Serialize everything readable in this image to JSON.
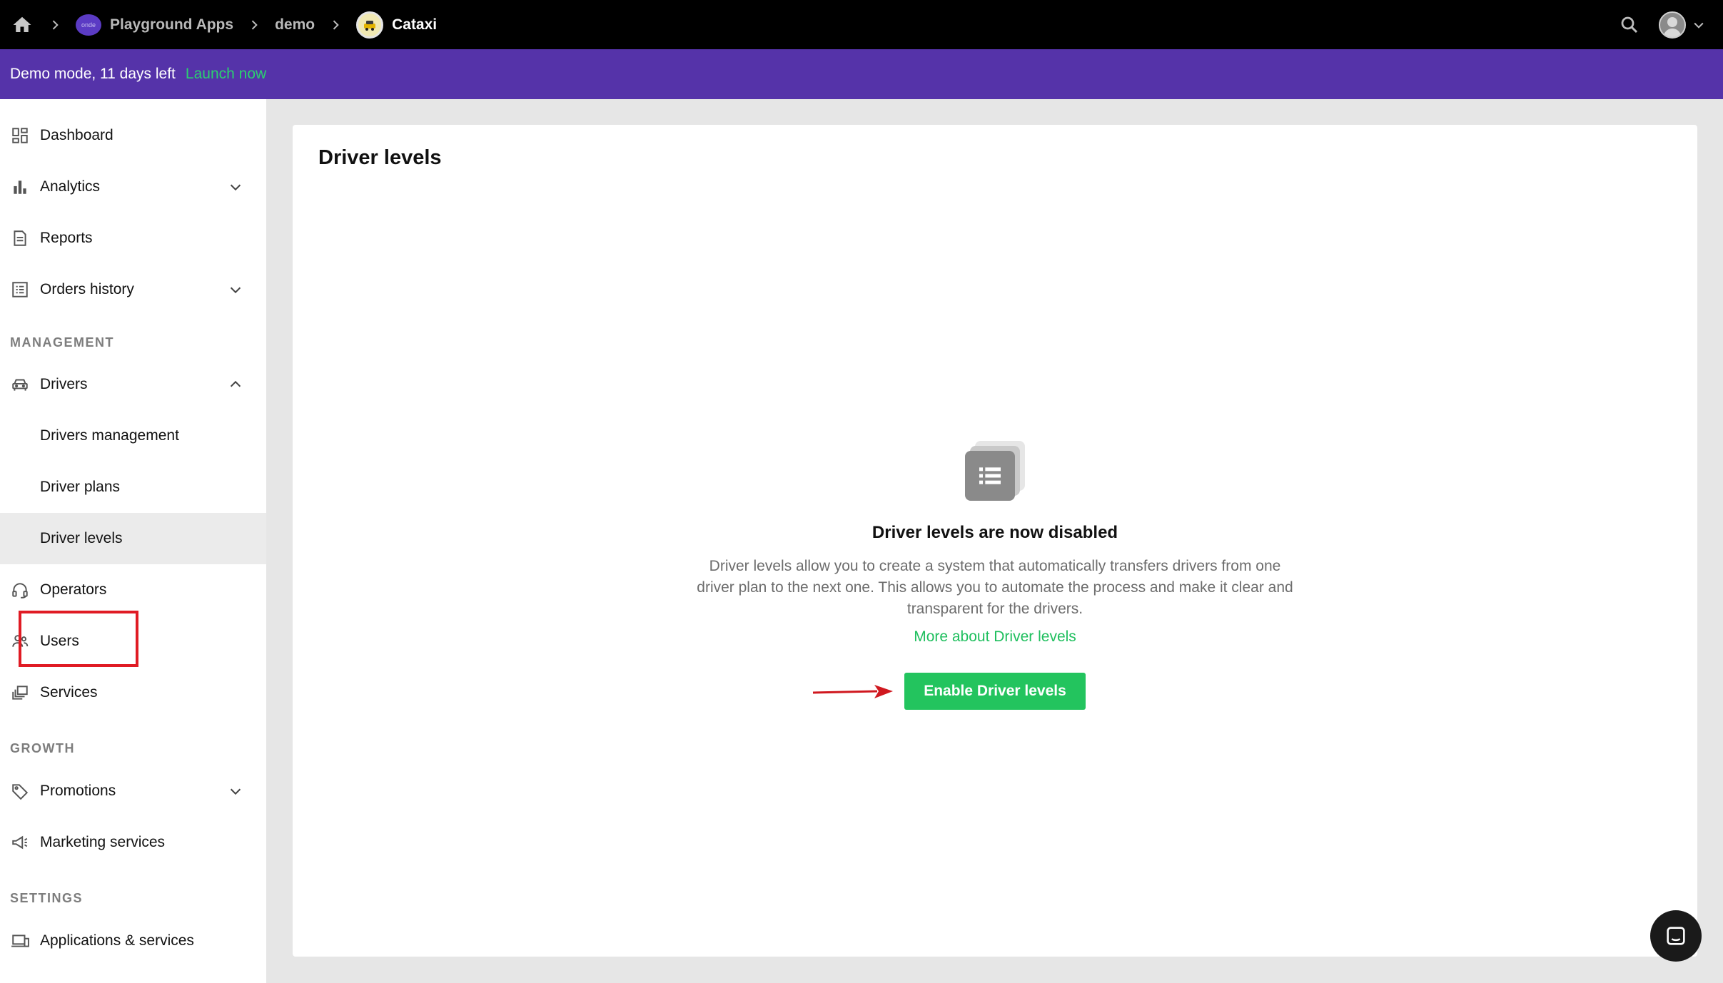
{
  "breadcrumb": {
    "items": [
      {
        "label": "Playground Apps",
        "logo_text": "onde"
      },
      {
        "label": "demo"
      },
      {
        "label": "Cataxi"
      }
    ]
  },
  "banner": {
    "text": "Demo mode, 11 days left",
    "link": "Launch now"
  },
  "sidebar": {
    "items": {
      "dashboard": "Dashboard",
      "analytics": "Analytics",
      "reports": "Reports",
      "orders_history": "Orders history",
      "drivers": "Drivers",
      "drivers_management": "Drivers management",
      "driver_plans": "Driver plans",
      "driver_levels": "Driver levels",
      "operators": "Operators",
      "users": "Users",
      "services": "Services",
      "promotions": "Promotions",
      "marketing_services": "Marketing services",
      "applications_services": "Applications & services"
    },
    "sections": {
      "management": "MANAGEMENT",
      "growth": "GROWTH",
      "settings": "SETTINGS"
    },
    "active": "Driver levels"
  },
  "main": {
    "title": "Driver levels",
    "empty_heading": "Driver levels are now disabled",
    "empty_description": "Driver levels allow you to create a system that automatically transfers drivers from one driver plan to the next one. This allows you to automate the process and make it clear and transparent for the drivers.",
    "more_link": "More about Driver levels",
    "enable_button": "Enable Driver levels"
  },
  "colors": {
    "topbar": "#000000",
    "banner": "#5533a9",
    "accent_green": "#23c45e",
    "highlight_red": "#e01b24"
  },
  "icons": [
    "home-icon",
    "chevron-right-icon",
    "search-icon",
    "chevron-down-icon",
    "chevron-up-icon",
    "dashboard-icon",
    "bar-chart-icon",
    "report-icon",
    "list-icon",
    "car-icon",
    "headset-icon",
    "users-icon",
    "services-icon",
    "tag-icon",
    "megaphone-icon",
    "devices-icon",
    "chat-icon"
  ]
}
